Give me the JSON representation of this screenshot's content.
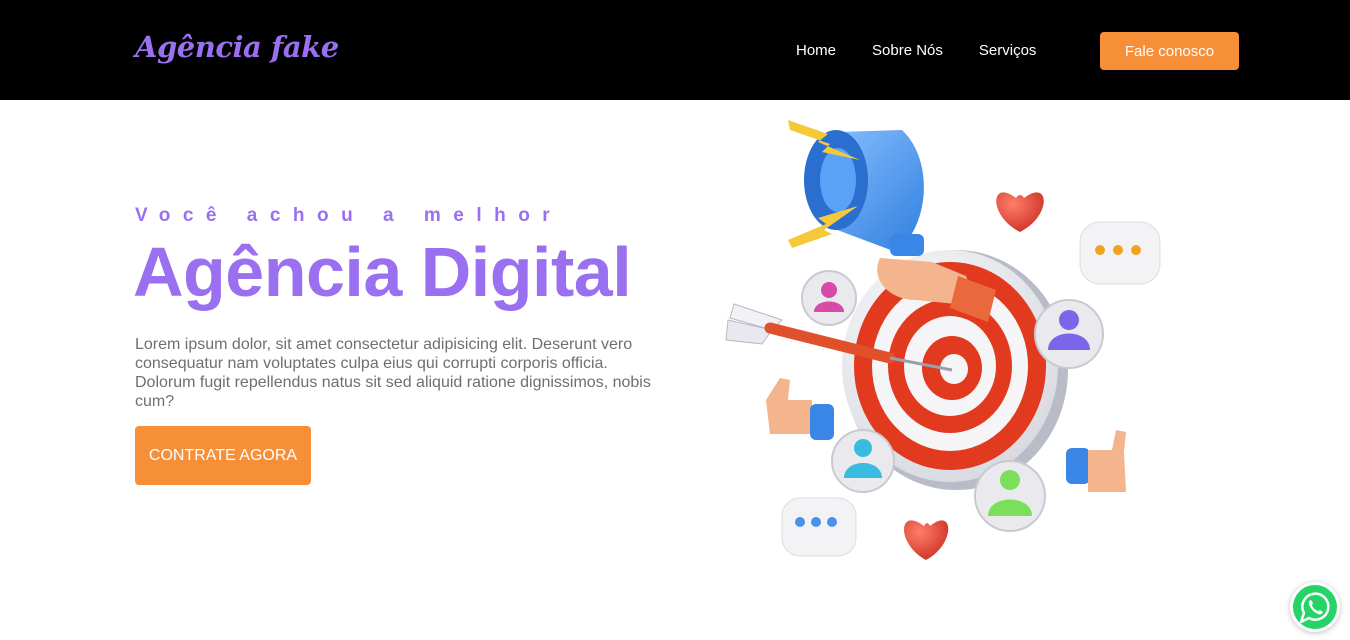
{
  "header": {
    "logo": "Agência fake",
    "nav": [
      {
        "label": "Home"
      },
      {
        "label": "Sobre Nós"
      },
      {
        "label": "Serviços"
      }
    ],
    "cta_label": "Fale conosco"
  },
  "hero": {
    "pretitle": "Você achou a melhor",
    "title": "Agência Digital",
    "description": "Lorem ipsum dolor, sit amet consectetur adipisicing elit. Deserunt vero consequatur nam voluptates culpa eius qui corrupti corporis officia. Dolorum fugit repellendus natus sit sed aliquid ratione dignissimos, nobis cum?",
    "cta_label": "CONTRATE AGORA"
  },
  "illustration": {
    "icons": [
      "megaphone-icon",
      "target-icon",
      "dart-icon",
      "heart-icon",
      "chat-bubble-icon",
      "user-icon",
      "thumbs-up-icon",
      "lightning-icon"
    ]
  },
  "floating": {
    "icon": "whatsapp-icon"
  },
  "colors": {
    "header_bg": "#000000",
    "accent_purple": "#9a6ff0",
    "accent_orange": "#f78f39",
    "text_gray": "#6f6f6f",
    "whatsapp_green": "#25d366"
  }
}
